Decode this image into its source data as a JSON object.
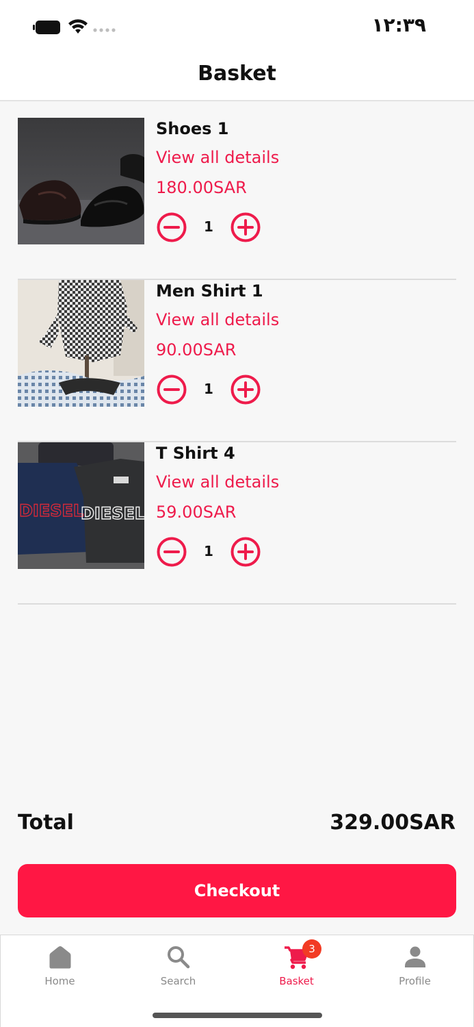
{
  "status_bar": {
    "time": "١٢:٣٩",
    "battery_icon": "battery-icon",
    "wifi_icon": "wifi-icon",
    "signal_icon": "signal-icon"
  },
  "header": {
    "title": "Basket"
  },
  "items": [
    {
      "name": "Shoes 1",
      "details_link": "View all details",
      "price": "180.00SAR",
      "quantity": "1",
      "image": "shoes-photo"
    },
    {
      "name": "Men Shirt 1",
      "details_link": "View all details",
      "price": "90.00SAR",
      "quantity": "1",
      "image": "shirt-photo"
    },
    {
      "name": "T Shirt 4",
      "details_link": "View all details",
      "price": "59.00SAR",
      "quantity": "1",
      "image": "tshirt-photo",
      "image_text": "DIESEL"
    }
  ],
  "summary": {
    "total_label": "Total",
    "total_value": "329.00SAR"
  },
  "checkout": {
    "label": "Checkout"
  },
  "tab_bar": {
    "tabs": [
      {
        "label": "Home",
        "icon": "home-icon",
        "active": false
      },
      {
        "label": "Search",
        "icon": "search-icon",
        "active": false
      },
      {
        "label": "Basket",
        "icon": "cart-icon",
        "active": true,
        "badge": "3"
      },
      {
        "label": "Profile",
        "icon": "person-icon",
        "active": false
      }
    ]
  },
  "colors": {
    "accent": "#ee1b4b",
    "checkout_button": "#ff1744",
    "badge": "#f23b24",
    "inactive_tab": "#8a8a8a"
  }
}
